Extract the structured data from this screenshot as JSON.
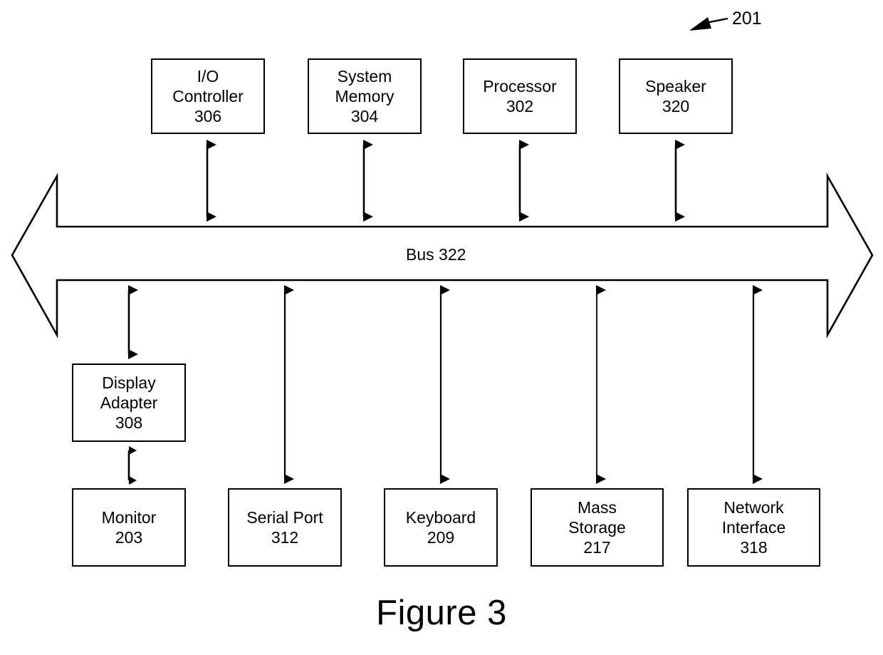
{
  "figure": {
    "caption": "Figure 3",
    "reference_numeral": "201"
  },
  "bus": {
    "label": "Bus 322"
  },
  "top_row": [
    {
      "lines": [
        "I/O",
        "Controller",
        "306"
      ],
      "name": "io-controller"
    },
    {
      "lines": [
        "System",
        "Memory",
        "304"
      ],
      "name": "system-memory"
    },
    {
      "lines": [
        "Processor",
        "302"
      ],
      "name": "processor"
    },
    {
      "lines": [
        "Speaker",
        "320"
      ],
      "name": "speaker"
    }
  ],
  "adapter": {
    "lines": [
      "Display",
      "Adapter",
      "308"
    ],
    "name": "display-adapter"
  },
  "bottom_row": [
    {
      "lines": [
        "Monitor",
        "203"
      ],
      "name": "monitor"
    },
    {
      "lines": [
        "Serial Port",
        "312"
      ],
      "name": "serial-port"
    },
    {
      "lines": [
        "Keyboard",
        "209"
      ],
      "name": "keyboard"
    },
    {
      "lines": [
        "Mass",
        "Storage",
        "217"
      ],
      "name": "mass-storage"
    },
    {
      "lines": [
        "Network",
        "Interface",
        "318"
      ],
      "name": "network-interface"
    }
  ],
  "colors": {
    "stroke": "#000000",
    "background": "#ffffff"
  },
  "diagram_data": {
    "type": "block-diagram",
    "title": "Figure 3",
    "nodes": [
      {
        "id": "306",
        "label": "I/O Controller",
        "numeral": "306",
        "group": "top"
      },
      {
        "id": "304",
        "label": "System Memory",
        "numeral": "304",
        "group": "top"
      },
      {
        "id": "302",
        "label": "Processor",
        "numeral": "302",
        "group": "top"
      },
      {
        "id": "320",
        "label": "Speaker",
        "numeral": "320",
        "group": "top"
      },
      {
        "id": "322",
        "label": "Bus",
        "numeral": "322",
        "group": "bus"
      },
      {
        "id": "308",
        "label": "Display Adapter",
        "numeral": "308",
        "group": "middle"
      },
      {
        "id": "203",
        "label": "Monitor",
        "numeral": "203",
        "group": "bottom"
      },
      {
        "id": "312",
        "label": "Serial Port",
        "numeral": "312",
        "group": "bottom"
      },
      {
        "id": "209",
        "label": "Keyboard",
        "numeral": "209",
        "group": "bottom"
      },
      {
        "id": "217",
        "label": "Mass Storage",
        "numeral": "217",
        "group": "bottom"
      },
      {
        "id": "318",
        "label": "Network Interface",
        "numeral": "318",
        "group": "bottom"
      }
    ],
    "edges": [
      {
        "from": "306",
        "to": "322",
        "style": "bidirectional"
      },
      {
        "from": "304",
        "to": "322",
        "style": "bidirectional"
      },
      {
        "from": "302",
        "to": "322",
        "style": "bidirectional"
      },
      {
        "from": "320",
        "to": "322",
        "style": "bidirectional"
      },
      {
        "from": "322",
        "to": "308",
        "style": "bidirectional"
      },
      {
        "from": "308",
        "to": "203",
        "style": "bidirectional"
      },
      {
        "from": "322",
        "to": "312",
        "style": "bidirectional"
      },
      {
        "from": "322",
        "to": "209",
        "style": "bidirectional"
      },
      {
        "from": "322",
        "to": "217",
        "style": "bidirectional"
      },
      {
        "from": "322",
        "to": "318",
        "style": "bidirectional"
      }
    ]
  }
}
